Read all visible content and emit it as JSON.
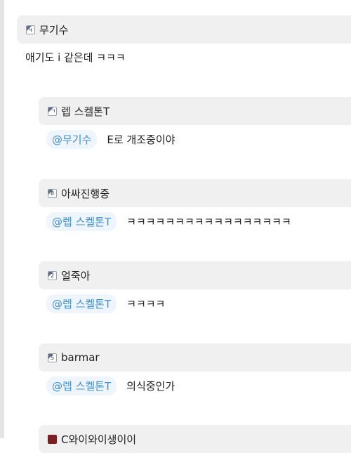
{
  "comments": [
    {
      "author": "무기수",
      "level_glyph": "ч",
      "mention": "",
      "text": "애기도 i 같은데 ㅋㅋㅋ"
    },
    {
      "author": "렙 스켈톤T",
      "level_glyph": "ㄱ",
      "mention": "@무기수",
      "text": "E로 개조중이야"
    },
    {
      "author": "아싸진행중",
      "level_glyph": "8",
      "mention": "@렙 스켈톤T",
      "text": "ㅋㅋㅋㅋㅋㅋㅋㅋㅋㅋㅋㅋㅋㅋㅋㅋㅋ"
    },
    {
      "author": "얼죽아",
      "level_glyph": "2",
      "mention": "@렙 스켈톤T",
      "text": "ㅋㅋㅋㅋ"
    },
    {
      "author": "barmar",
      "level_glyph": "5",
      "mention": "@렙 스켈톤T",
      "text": "의식중인가"
    },
    {
      "author": "C와이와이생이이",
      "level_glyph": "",
      "mention": "",
      "text": ""
    }
  ],
  "colors": {
    "bar": "#f0f0f0",
    "mention_text": "#3d8fd6",
    "mention_bg": "#eef5fc"
  },
  "icons": {
    "level": "level-badge-icon"
  }
}
